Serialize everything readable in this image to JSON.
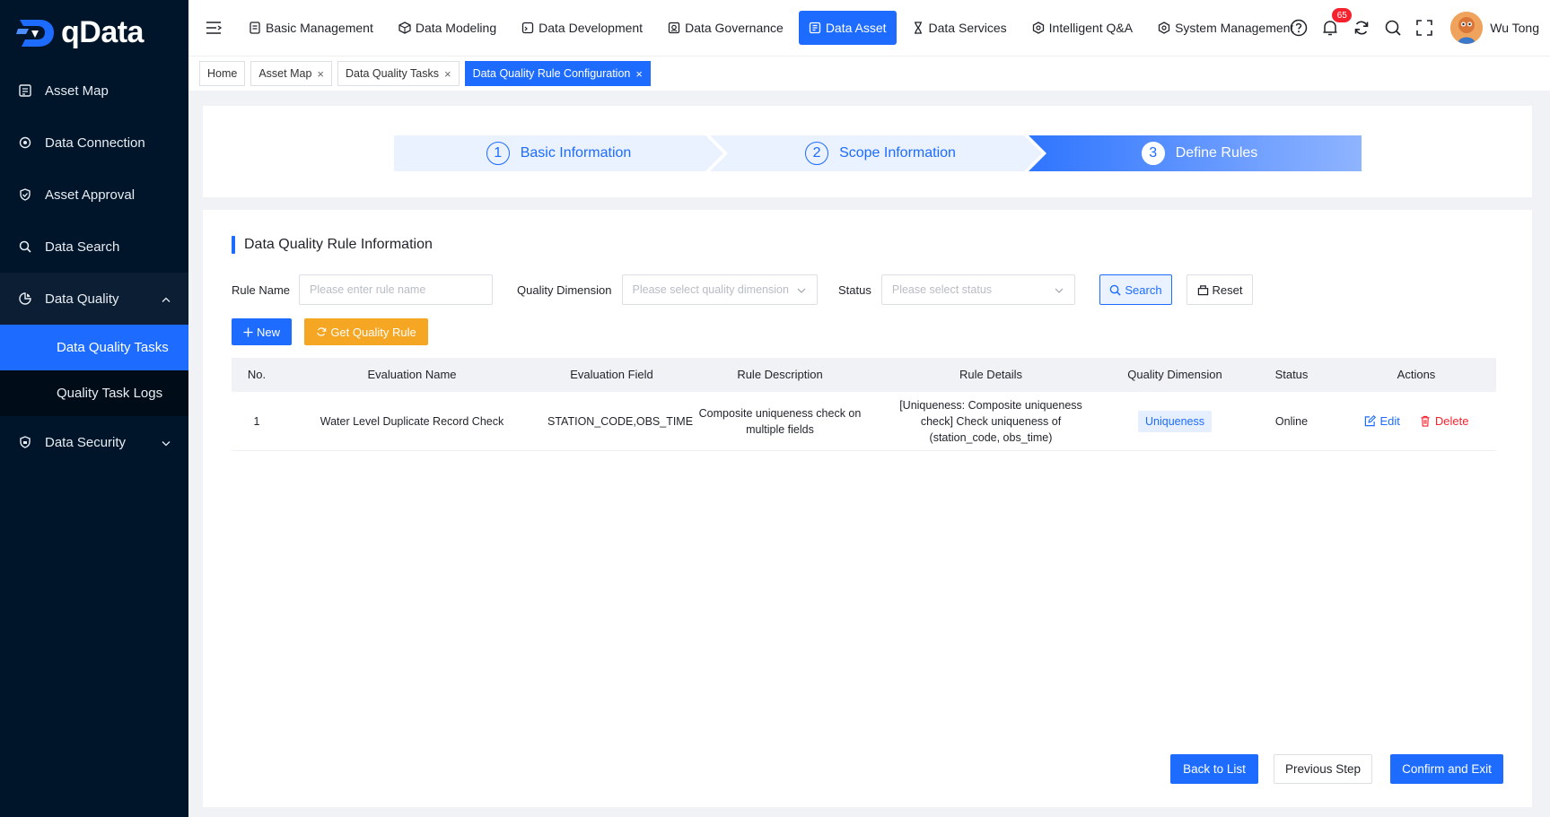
{
  "brand": {
    "name": "qData"
  },
  "sidebar": {
    "items": [
      {
        "label": "Asset Map",
        "icon": "asset-map-icon"
      },
      {
        "label": "Data Connection",
        "icon": "connection-icon"
      },
      {
        "label": "Asset Approval",
        "icon": "approval-icon"
      },
      {
        "label": "Data Search",
        "icon": "search-icon"
      },
      {
        "label": "Data Quality",
        "icon": "quality-icon",
        "expanded": true,
        "children": [
          {
            "label": "Data Quality Tasks",
            "active": true
          },
          {
            "label": "Quality Task Logs"
          }
        ]
      },
      {
        "label": "Data Security",
        "icon": "security-icon"
      }
    ]
  },
  "topnav": {
    "items": [
      {
        "label": "Basic Management"
      },
      {
        "label": "Data Modeling"
      },
      {
        "label": "Data Development"
      },
      {
        "label": "Data Governance"
      },
      {
        "label": "Data Asset",
        "active": true
      },
      {
        "label": "Data Services"
      },
      {
        "label": "Intelligent Q&A"
      },
      {
        "label": "System Management"
      }
    ],
    "notification_count": "65",
    "user_name": "Wu Tong"
  },
  "tabs": [
    {
      "label": "Home"
    },
    {
      "label": "Asset Map"
    },
    {
      "label": "Data Quality Tasks"
    },
    {
      "label": "Data Quality Rule Configuration",
      "active": true
    }
  ],
  "steps": [
    {
      "num": "1",
      "label": "Basic Information"
    },
    {
      "num": "2",
      "label": "Scope Information"
    },
    {
      "num": "3",
      "label": "Define Rules",
      "active": true
    }
  ],
  "section": {
    "title": "Data Quality Rule Information"
  },
  "filters": {
    "rule_name_label": "Rule Name",
    "rule_name_placeholder": "Please enter rule name",
    "dimension_label": "Quality Dimension",
    "dimension_placeholder": "Please select quality dimension",
    "status_label": "Status",
    "status_placeholder": "Please select status",
    "search_label": "Search",
    "reset_label": "Reset"
  },
  "toolbar": {
    "new_label": "New",
    "get_rule_label": "Get Quality Rule"
  },
  "table": {
    "columns": [
      "No.",
      "Evaluation Name",
      "Evaluation Field",
      "Rule Description",
      "Rule Details",
      "Quality Dimension",
      "Status",
      "Actions"
    ],
    "rows": [
      {
        "no": "1",
        "name": "Water Level Duplicate Record Check",
        "field": "STATION_CODE,OBS_TIME",
        "description": "Composite uniqueness check on multiple fields",
        "details": "[Uniqueness: Composite uniqueness check] Check uniqueness of (station_code, obs_time)",
        "dimension": "Uniqueness",
        "status": "Online",
        "edit_label": "Edit",
        "delete_label": "Delete"
      }
    ]
  },
  "footer": {
    "back_label": "Back to List",
    "prev_label": "Previous Step",
    "confirm_label": "Confirm and Exit"
  },
  "colors": {
    "primary": "#1d6cff",
    "sidebar_bg": "#001529",
    "warning": "#f5a623",
    "danger": "#f5222d"
  }
}
